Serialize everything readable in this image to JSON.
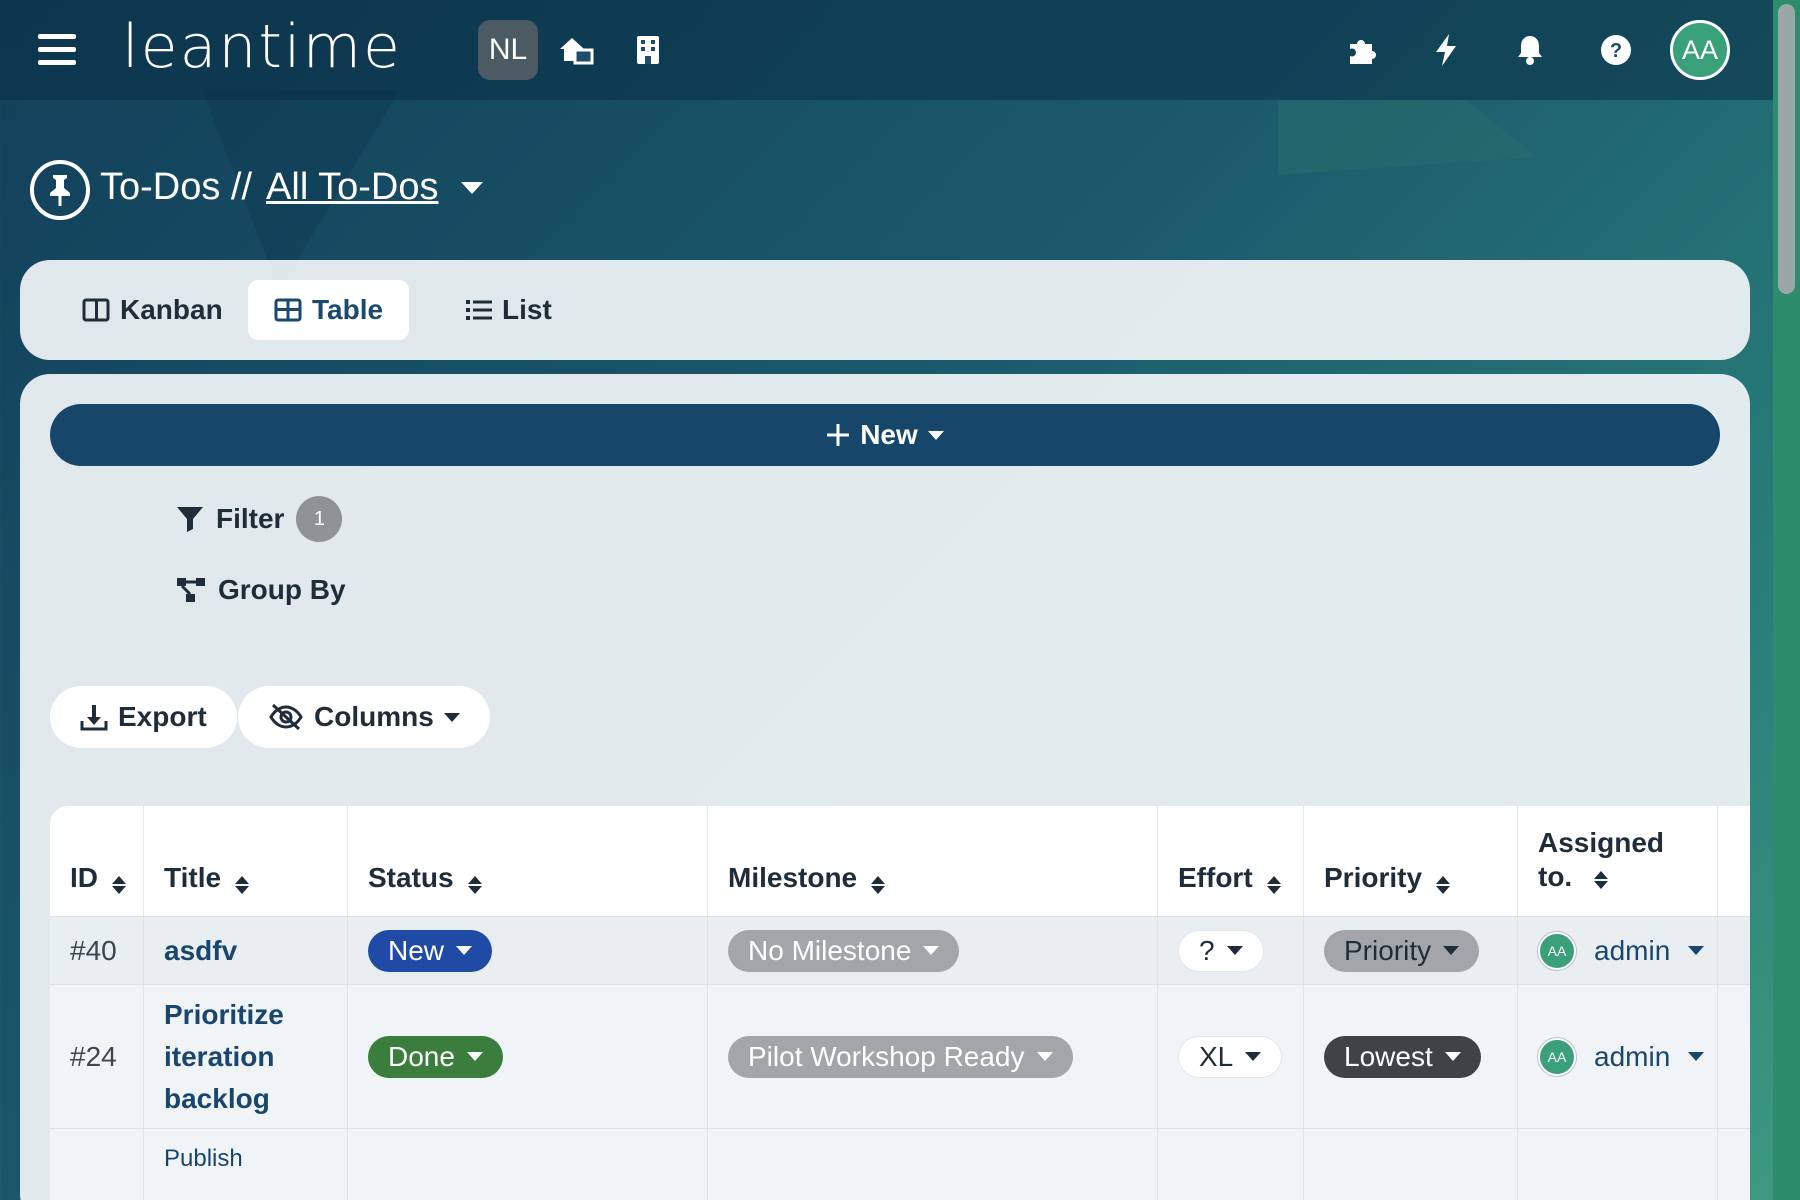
{
  "app": {
    "logo": "leantime",
    "project_initials": "NL",
    "user_initials": "AA"
  },
  "header_icons": [
    "menu-icon",
    "home-work-icon",
    "building-icon",
    "puzzle-icon",
    "lightning-icon",
    "bell-icon",
    "help-icon"
  ],
  "breadcrumb": {
    "section": "To-Dos //",
    "current": "All To-Dos"
  },
  "views": [
    {
      "label": "Kanban",
      "icon": "kanban-icon",
      "active": false
    },
    {
      "label": "Table",
      "icon": "table-icon",
      "active": true
    },
    {
      "label": "List",
      "icon": "list-icon",
      "active": false
    }
  ],
  "toolbar": {
    "new_label": "New",
    "filter_label": "Filter",
    "filter_count": "1",
    "groupby_label": "Group By",
    "export_label": "Export",
    "columns_label": "Columns"
  },
  "table": {
    "headers": [
      "ID",
      "Title",
      "Status",
      "Milestone",
      "Effort",
      "Priority",
      "Assigned to."
    ],
    "rows": [
      {
        "id": "#40",
        "title": "asdfv",
        "status": "New",
        "milestone": "No Milestone",
        "effort": "?",
        "priority": "Priority",
        "assignee_initials": "AA",
        "assignee": "admin"
      },
      {
        "id": "#24",
        "title": "Prioritize iteration backlog",
        "status": "Done",
        "milestone": "Pilot Workshop Ready",
        "effort": "XL",
        "priority": "Lowest",
        "assignee_initials": "AA",
        "assignee": "admin"
      },
      {
        "id": "",
        "title": "Publish",
        "status": "",
        "milestone": "",
        "effort": "",
        "priority": "",
        "assignee_initials": "",
        "assignee": ""
      }
    ]
  },
  "colors": {
    "primary": "#16466a",
    "status_new": "#1f4ba6",
    "status_done": "#3a7d3c",
    "avatar": "#3aa07a"
  }
}
